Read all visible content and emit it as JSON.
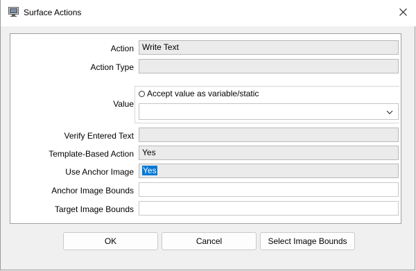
{
  "window": {
    "title": "Surface Actions",
    "app_icon": "computer-monitor-icon",
    "close_icon": "close-icon"
  },
  "form": {
    "action_label": "Action",
    "action_value": "Write Text",
    "action_type_label": "Action Type",
    "action_type_value": "",
    "value_label": "Value",
    "accept_value_label": "Accept value as variable/static",
    "value_combo_value": "",
    "verify_label": "Verify Entered Text",
    "verify_value": "",
    "template_label": "Template-Based Action",
    "template_value": "Yes",
    "use_anchor_label": "Use Anchor Image",
    "use_anchor_value": "Yes",
    "anchor_bounds_label": "Anchor Image Bounds",
    "anchor_bounds_value": "",
    "target_bounds_label": "Target Image Bounds",
    "target_bounds_value": ""
  },
  "buttons": {
    "ok": "OK",
    "cancel": "Cancel",
    "select_bounds": "Select Image Bounds"
  },
  "colors": {
    "selection": "#0078d7",
    "readonly_field": "#ebebeb"
  }
}
